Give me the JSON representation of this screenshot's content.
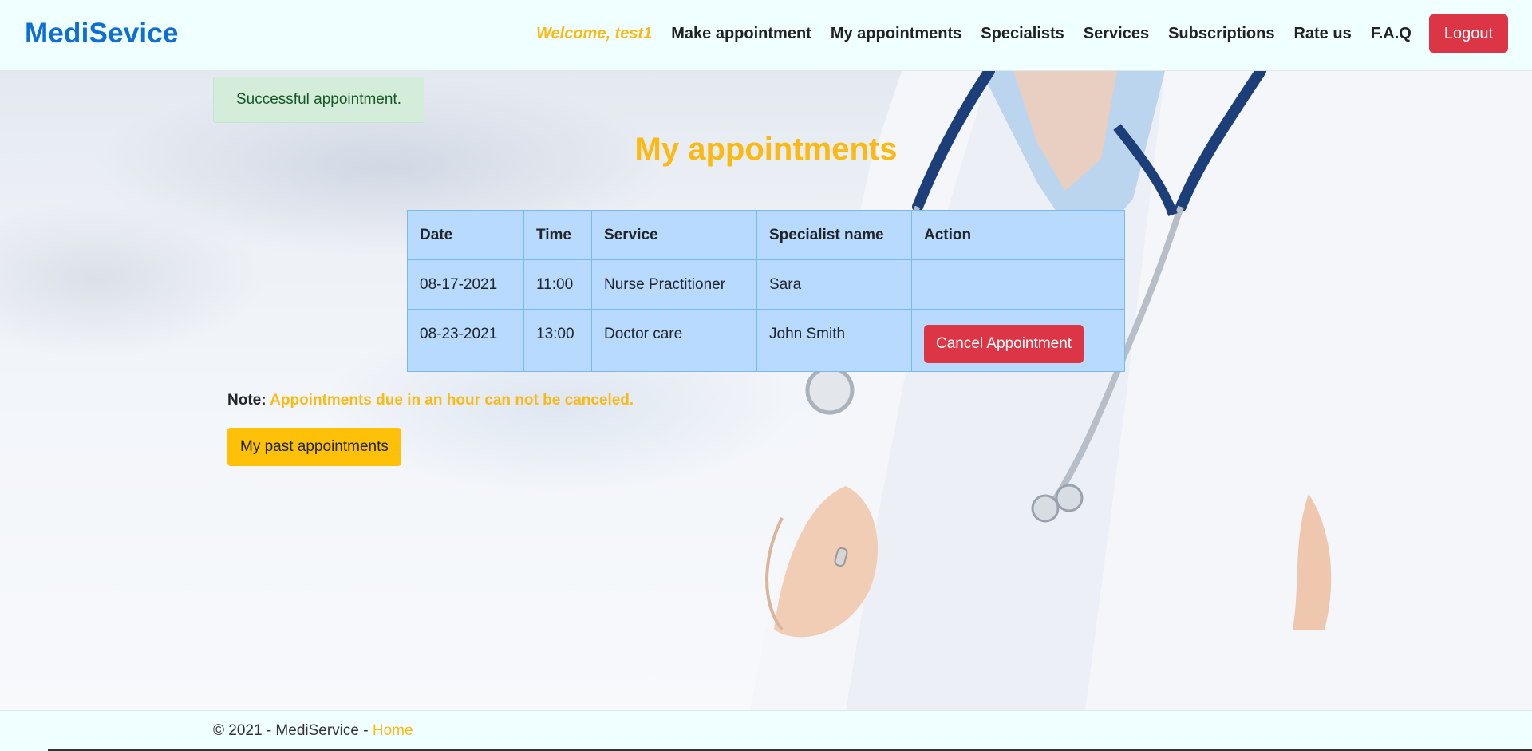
{
  "navbar": {
    "brand": "MediSevice",
    "welcome": "Welcome, test1",
    "links": [
      "Make appointment",
      "My appointments",
      "Specialists",
      "Services",
      "Subscriptions",
      "Rate us",
      "F.A.Q"
    ],
    "logout_label": "Logout"
  },
  "alert": {
    "message": "Successful appointment."
  },
  "main": {
    "title": "My appointments",
    "table": {
      "headers": [
        "Date",
        "Time",
        "Service",
        "Specialist name",
        "Action"
      ],
      "rows": [
        {
          "date": "08-17-2021",
          "time": "11:00",
          "service": "Nurse Practitioner",
          "specialist": "Sara",
          "action": ""
        },
        {
          "date": "08-23-2021",
          "time": "13:00",
          "service": "Doctor care",
          "specialist": "John Smith",
          "action": "Cancel Appointment"
        }
      ]
    },
    "note_label": "Note:",
    "note_text": "Appointments due in an hour can not be canceled.",
    "past_button": "My past appointments"
  },
  "footer": {
    "text": "© 2021 - MediService - ",
    "home_link": "Home"
  },
  "colors": {
    "brand": "#0d6ed3",
    "accent": "#fdb913",
    "danger": "#dc3545",
    "table_bg": "#b8daff",
    "success_bg": "#d4edda"
  }
}
